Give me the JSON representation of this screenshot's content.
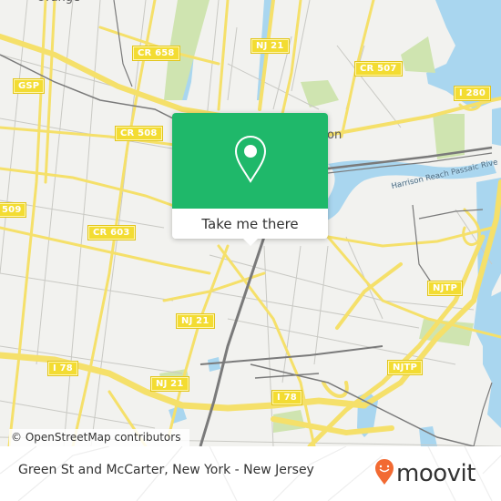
{
  "map": {
    "place_labels": [
      {
        "id": "orange",
        "text": "Orange"
      },
      {
        "id": "newark-partial",
        "text": "on"
      }
    ],
    "river_label": "Harrison Reach Passaic Rive",
    "shields": [
      {
        "id": "cr658",
        "text": "CR 658"
      },
      {
        "id": "nj21-top",
        "text": "NJ 21"
      },
      {
        "id": "cr507",
        "text": "CR 507"
      },
      {
        "id": "gsp",
        "text": "GSP"
      },
      {
        "id": "i280",
        "text": "I 280"
      },
      {
        "id": "cr508",
        "text": "CR 508"
      },
      {
        "id": "cr509",
        "text": "509"
      },
      {
        "id": "cr603",
        "text": "CR 603"
      },
      {
        "id": "njtp-upper",
        "text": "NJTP"
      },
      {
        "id": "nj21-mid",
        "text": "NJ 21"
      },
      {
        "id": "i78-left",
        "text": "I 78"
      },
      {
        "id": "nj21-low",
        "text": "NJ 21"
      },
      {
        "id": "njtp-lower",
        "text": "NJTP"
      },
      {
        "id": "i78-right",
        "text": "I 78"
      }
    ],
    "attribution": "© OpenStreetMap contributors",
    "colors": {
      "land": "#f2f2ef",
      "water": "#a9d6ef",
      "park": "#cfe4b0",
      "road_major": "#f5e06a",
      "road_minor": "#c9c9c4",
      "rail": "#7a7a7a"
    }
  },
  "popup": {
    "icon": "map-pin-icon",
    "action_label": "Take me there",
    "accent_color": "#1fb86a"
  },
  "footer": {
    "title": "Green St and McCarter, New York - New Jersey",
    "brand": "moovit",
    "brand_icon": "moovit-smile-pin-icon",
    "brand_color": "#f26a32"
  }
}
